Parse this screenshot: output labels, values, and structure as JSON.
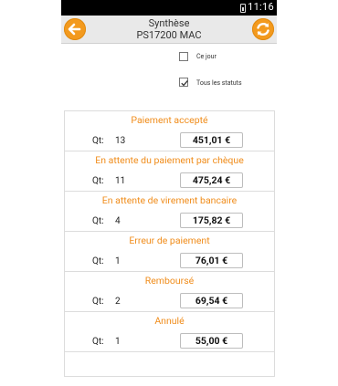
{
  "status_bar": {
    "time": "11:16",
    "battery_icon": "battery-icon"
  },
  "header": {
    "title": "Synthèse",
    "subtitle": "PS17200 MAC",
    "back_icon": "arrow-left-icon",
    "refresh_icon": "refresh-icon",
    "accent_color": "#f39a1e"
  },
  "filters": {
    "today_label": "Ce jour",
    "today_checked": false,
    "all_statuses_label": "Tous les statuts",
    "all_statuses_checked": true
  },
  "qt_label": "Qt:",
  "sections": [
    {
      "title": "Paiement accepté",
      "qt": "13",
      "amount": "451,01 €"
    },
    {
      "title": "En attente du paiement par chèque",
      "qt": "11",
      "amount": "475,24 €"
    },
    {
      "title": "En attente de virement bancaire",
      "qt": "4",
      "amount": "175,82 €"
    },
    {
      "title": "Erreur de paiement",
      "qt": "1",
      "amount": "76,01 €"
    },
    {
      "title": "Remboursé",
      "qt": "2",
      "amount": "69,54 €"
    },
    {
      "title": "Annulé",
      "qt": "1",
      "amount": "55,00 €"
    }
  ]
}
